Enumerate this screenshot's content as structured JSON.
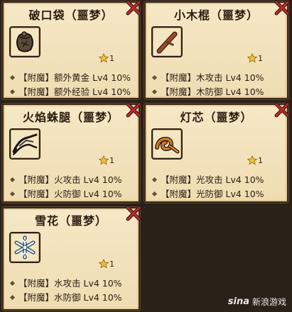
{
  "cards": [
    {
      "title": "破口袋（噩梦）",
      "star_count": "1",
      "attrs": [
        "【附魔】额外黄金  Lv4  10%",
        "【附魔】额外经验  Lv4  10%"
      ]
    },
    {
      "title": "小木棍（噩梦）",
      "star_count": "1",
      "attrs": [
        "【附魔】木攻击  Lv4  10%",
        "【附魔】木防御  Lv4  10%"
      ]
    },
    {
      "title": "火焰蛛腿（噩梦）",
      "star_count": "1",
      "attrs": [
        "【附魔】火攻击  Lv4  10%",
        "【附魔】火防御  Lv4  10%"
      ]
    },
    {
      "title": "灯芯（噩梦）",
      "star_count": "1",
      "attrs": [
        "【附魔】光攻击  Lv4  10%",
        "【附魔】光防御  Lv4  10%"
      ]
    },
    {
      "title": "雪花（噩梦）",
      "star_count": "1",
      "attrs": [
        "【附魔】水攻击  Lv4  10%",
        "【附魔】水防御  Lv4  10%"
      ]
    }
  ],
  "watermark": {
    "brand": "sina",
    "text": "新浪游戏"
  },
  "colors": {
    "parchment": "#f6e8c6",
    "close_red": "#c0282a",
    "star_gold": "#f2c12e"
  }
}
